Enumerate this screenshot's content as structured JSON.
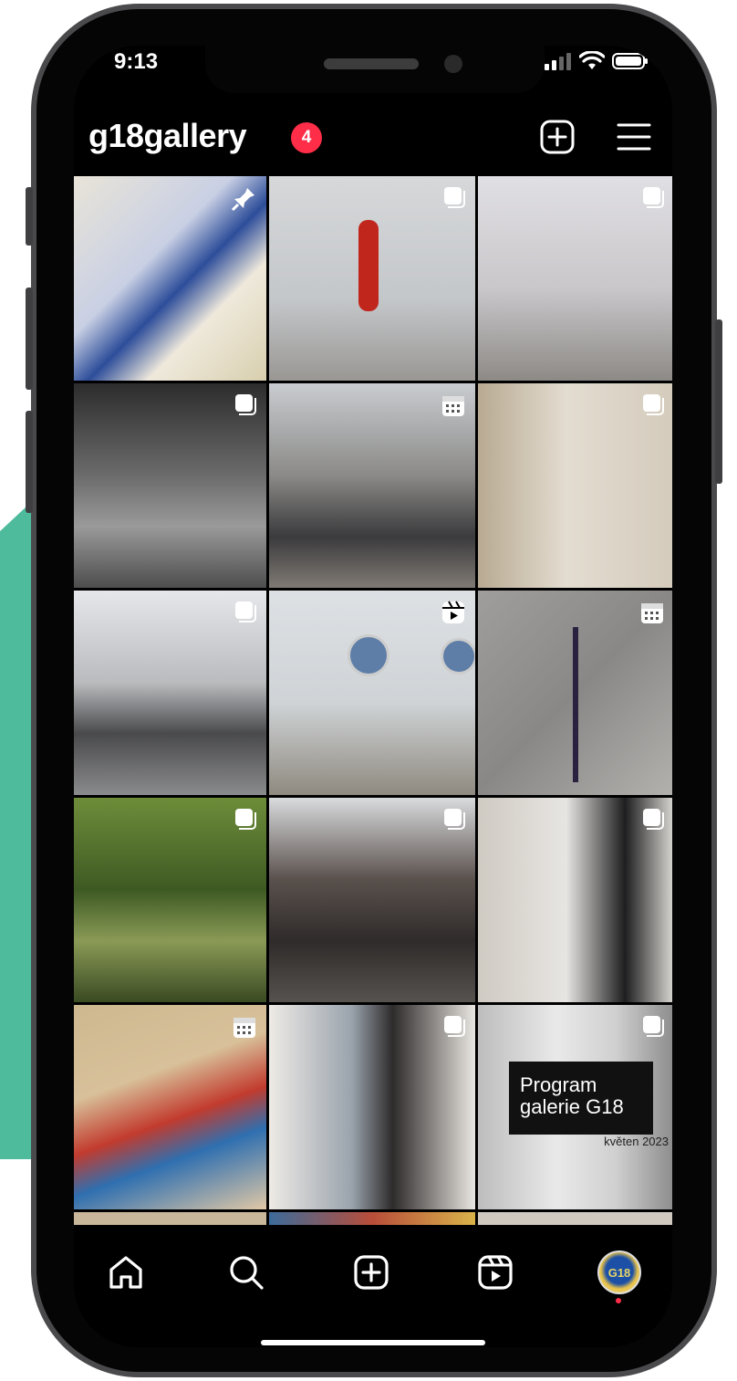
{
  "status_bar": {
    "time": "9:13"
  },
  "profile": {
    "username": "g18gallery",
    "notification_count": "4"
  },
  "header_icons": [
    "new-post-icon",
    "menu-icon"
  ],
  "grid": {
    "tiles": [
      {
        "desc": "blueprints",
        "icon": "pin"
      },
      {
        "desc": "red sculpture",
        "icon": "carousel"
      },
      {
        "desc": "gallery visitors",
        "icon": "carousel"
      },
      {
        "desc": "park bw",
        "icon": "carousel"
      },
      {
        "desc": "group crowd",
        "icon": "event"
      },
      {
        "desc": "wall sculpture",
        "icon": "carousel"
      },
      {
        "desc": "gallery talk",
        "icon": "carousel"
      },
      {
        "desc": "plant vase",
        "icon": "reel"
      },
      {
        "desc": "tree coat rack",
        "icon": "event"
      },
      {
        "desc": "garden chairs",
        "icon": "carousel"
      },
      {
        "desc": "workshop table",
        "icon": "carousel"
      },
      {
        "desc": "fashion wall",
        "icon": "carousel"
      },
      {
        "desc": "card game",
        "icon": "event"
      },
      {
        "desc": "teens gallery",
        "icon": "carousel"
      },
      {
        "desc": "program card",
        "icon": "carousel"
      }
    ],
    "program_card": {
      "title": "Program galerie G18",
      "subtitle": "květen 2023"
    }
  },
  "bottom_nav": {
    "items": [
      "home-icon",
      "search-icon",
      "create-icon",
      "reels-icon",
      "profile-avatar"
    ],
    "avatar_text": "G18"
  },
  "colors": {
    "accent": "#ff2d48",
    "teal_bg": "#4dbb9c",
    "frame": "#4a4a4c"
  }
}
